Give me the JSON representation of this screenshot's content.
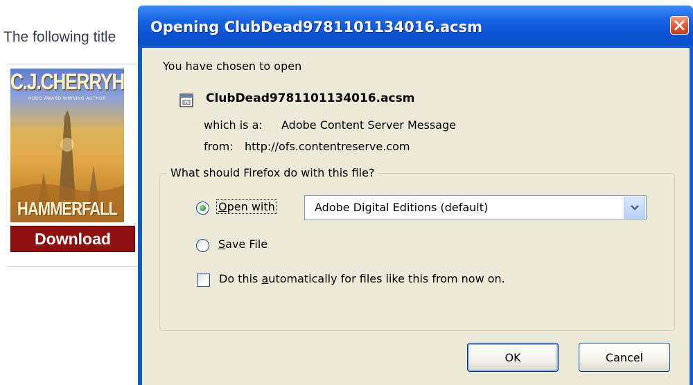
{
  "background": {
    "intro_text": "The following title",
    "cover": {
      "author": "C.J.CHERRYH",
      "tagline": "HUGO AWARD-WINNING AUTHOR",
      "title": "HAMMERFALL"
    },
    "download_label": "Download"
  },
  "dialog": {
    "title": "Opening ClubDead9781101134016.acsm",
    "intro": "You have chosen to open",
    "filename": "ClubDead9781101134016.acsm",
    "type_prefix": "which is a:",
    "type_value": "Adobe Content Server Message",
    "from_prefix": "from:",
    "from_value": "http://ofs.contentreserve.com",
    "question": "What should Firefox do with this file?",
    "open_with_label_mnemonic": "O",
    "open_with_label_rest": "pen with",
    "open_with_selected": true,
    "open_with_app": "Adobe Digital Editions (default)",
    "save_file_label_mnemonic": "S",
    "save_file_label_rest": "ave File",
    "auto_label_pre": "Do this ",
    "auto_label_mnemonic": "a",
    "auto_label_post": "utomatically for files like this from now on.",
    "auto_checked": false,
    "ok_label": "OK",
    "cancel_label": "Cancel"
  },
  "colors": {
    "titlebar": "#0a53d4",
    "client": "#ece9d8",
    "download_bg": "#8e1010",
    "close_button": "#e05a30"
  }
}
